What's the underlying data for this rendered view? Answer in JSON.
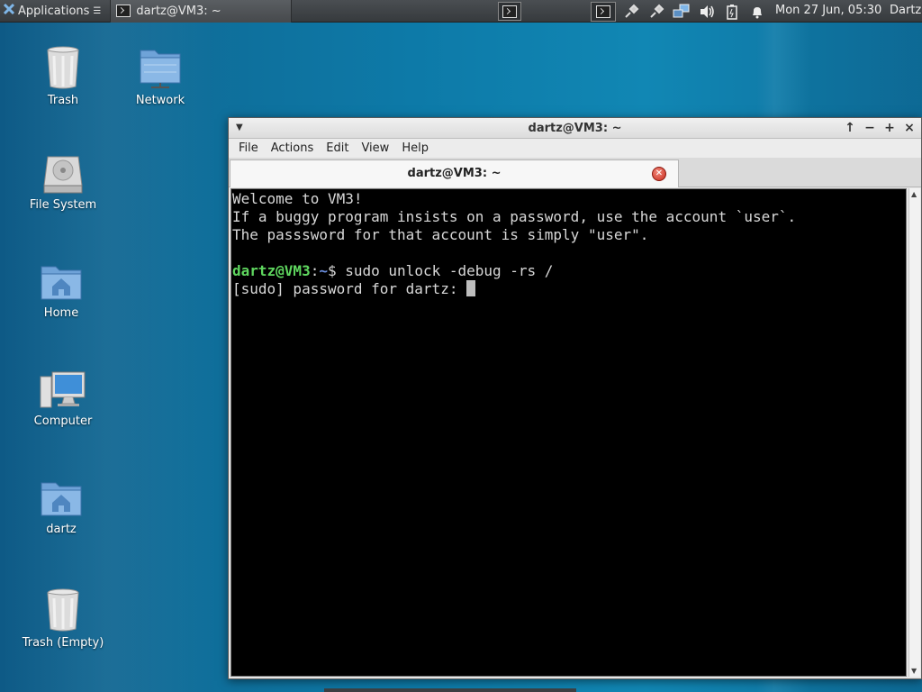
{
  "panel": {
    "applications_label": "Applications",
    "task_title": "dartz@VM3: ~",
    "clock": "Mon 27 Jun, 05:30",
    "user": "Dartz"
  },
  "desktop": {
    "icons": [
      {
        "label": "Trash",
        "icon": "trash-icon"
      },
      {
        "label": "Network",
        "icon": "network-folder-icon"
      },
      {
        "label": "File System",
        "icon": "drive-icon"
      },
      {
        "label": "Home",
        "icon": "home-folder-icon"
      },
      {
        "label": "Computer",
        "icon": "computer-icon"
      },
      {
        "label": "dartz",
        "icon": "home-folder-icon"
      },
      {
        "label": "Trash (Empty)",
        "icon": "trash-icon"
      }
    ]
  },
  "window": {
    "title": "dartz@VM3: ~",
    "menu": [
      "File",
      "Actions",
      "Edit",
      "View",
      "Help"
    ],
    "tab_title": "dartz@VM3: ~",
    "terminal": {
      "lines": [
        "Welcome to VM3!",
        "If a buggy program insists on a password, use the account `user`.",
        "The passsword for that account is simply \"user\".",
        ""
      ],
      "prompt_user": "dartz@VM3",
      "prompt_sep": ":",
      "prompt_path": "~",
      "prompt_symbol": "$ ",
      "command": "sudo unlock -debug -rs /",
      "sudo_prompt": "[sudo] password for dartz: "
    }
  },
  "colors": {
    "desktop": "#0d7aa8",
    "panel": "#3c3f42",
    "prompt_user": "#5fd75f",
    "prompt_path": "#6b8fe0",
    "terminal_bg": "#000000"
  }
}
